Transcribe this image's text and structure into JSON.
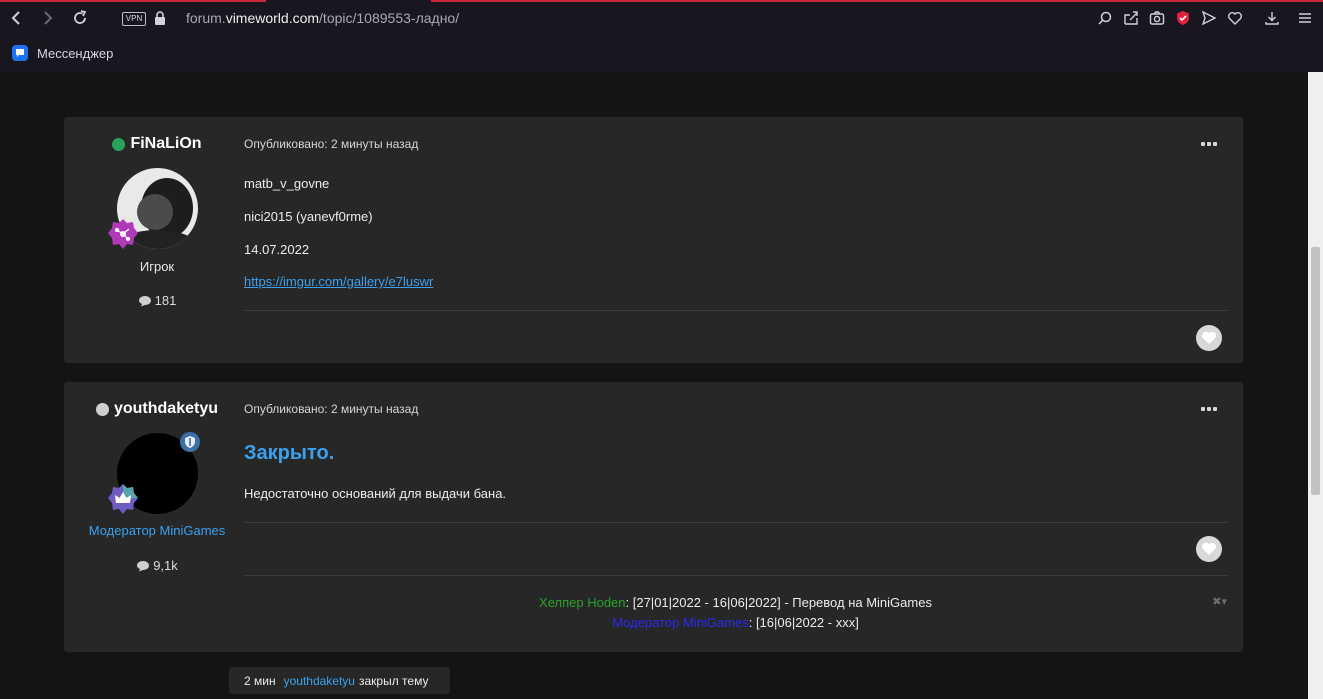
{
  "browser": {
    "url_base": "forum.",
    "url_domain": "vimeworld.com",
    "url_path": "/topic/1089553-ладно/",
    "vpn_label": "VPN",
    "bookmark_label": "Мессенджер",
    "accent_color": "#c8283c"
  },
  "posts": [
    {
      "author": "FiNaLiOn",
      "status_color": "#2aa35a",
      "group": "Игрок",
      "group_color": "#e8e8e8",
      "post_count": "181",
      "meta": "Опубликовано: 2 минуты назад",
      "lines": [
        "matb_v_govne",
        "nici2015 (yanevf0rme)",
        "14.07.2022"
      ],
      "link": "https://imgur.com/gallery/e7luswr"
    },
    {
      "author": "youthdaketyu",
      "status_color": "#cfcfcf",
      "group": "Модератор MiniGames",
      "group_color": "#3aa1ef",
      "post_count": "9,1k",
      "meta": "Опубликовано: 2 минуты назад",
      "heading": "Закрыто.",
      "text": "Недостаточно оснований для выдачи бана.",
      "signature": {
        "line1_role": "Хелпер Hoden",
        "line1_role_color": "#27a327",
        "line1_text": ": [27|01|2022 - 16|06|2022] - Перевод на MiniGames",
        "line2_role": "Модератор MiniGames",
        "line2_role_color": "#2a2af0",
        "line2_text": ": [16|06|2022 - xxx]"
      }
    }
  ],
  "event": {
    "time": "2 мин",
    "user": "youthdaketyu",
    "action": "закрыл тему"
  }
}
